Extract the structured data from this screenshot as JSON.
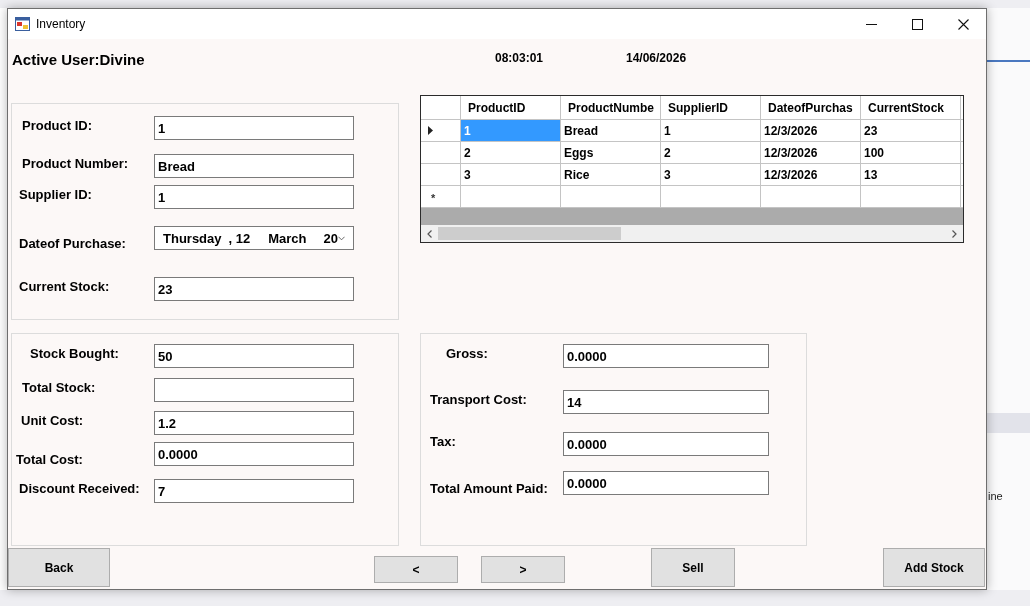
{
  "window": {
    "title": "Inventory"
  },
  "header": {
    "active_user": "Active User:Divine",
    "time": "08:03:01",
    "date": "14/06/2026"
  },
  "product_details": {
    "fields": [
      {
        "kind": "text",
        "label": "Product ID:",
        "value": "1"
      },
      {
        "kind": "text",
        "label": "Product Number:",
        "value": "Bread"
      },
      {
        "kind": "text",
        "label": "Supplier ID:",
        "value": "1"
      },
      {
        "kind": "date",
        "label": "Dateof Purchase:",
        "parts": [
          "Thursday",
          ", 12",
          "March",
          "20"
        ]
      },
      {
        "kind": "text",
        "label": "Current Stock:",
        "value": "23"
      }
    ]
  },
  "table": {
    "columns": [
      "ProductID",
      "ProductNumbe",
      "SupplierID",
      "DateofPurchas",
      "CurrentStock"
    ],
    "rows": [
      {
        "current": true,
        "cells": [
          {
            "text": "1",
            "selected": true
          },
          {
            "text": "Bread",
            "selected": false
          },
          {
            "text": "1",
            "selected": false
          },
          {
            "text": "12/3/2026",
            "selected": false
          },
          {
            "text": "23",
            "selected": false
          }
        ]
      },
      {
        "current": false,
        "cells": [
          {
            "text": "2",
            "selected": false
          },
          {
            "text": "Eggs",
            "selected": false
          },
          {
            "text": "2",
            "selected": false
          },
          {
            "text": "12/3/2026",
            "selected": false
          },
          {
            "text": "100",
            "selected": false
          }
        ]
      },
      {
        "current": false,
        "cells": [
          {
            "text": "3",
            "selected": false
          },
          {
            "text": "Rice",
            "selected": false
          },
          {
            "text": "3",
            "selected": false
          },
          {
            "text": "12/3/2026",
            "selected": false
          },
          {
            "text": "13",
            "selected": false
          }
        ]
      }
    ],
    "new_row_marker": "*"
  },
  "stock": {
    "fields": [
      {
        "kind": "text",
        "label": "Stock Bought:",
        "value": "50"
      },
      {
        "kind": "text",
        "label": "Total Stock:"
      },
      {
        "kind": "text",
        "label": "Unit Cost:",
        "value": "1.2"
      },
      {
        "kind": "text",
        "label": "Total Cost:",
        "value": "0.0000"
      },
      {
        "kind": "text",
        "label": "Discount Received:",
        "value": "7"
      }
    ]
  },
  "costs": {
    "fields": [
      {
        "kind": "text",
        "label": "Gross:",
        "value": "0.0000"
      },
      {
        "kind": "text",
        "label": "Transport Cost:",
        "value": "14"
      },
      {
        "kind": "text",
        "label": "Tax:",
        "value": "0.0000"
      },
      {
        "kind": "text",
        "label": "Total Amount Paid:",
        "value": "0.0000"
      }
    ]
  },
  "buttons": [
    {
      "kind": "action",
      "label": "Back"
    },
    {
      "kind": "nav",
      "label": "<"
    },
    {
      "kind": "nav",
      "label": ">"
    },
    {
      "kind": "action",
      "label": "Sell"
    },
    {
      "kind": "action",
      "label": "Add Stock"
    }
  ],
  "background": {
    "panel_text": "ine"
  }
}
